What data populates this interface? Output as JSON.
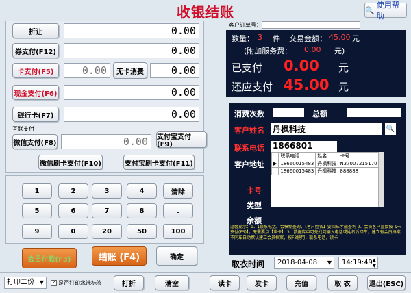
{
  "title": "收银结账",
  "help_button": "使用帮助",
  "left": {
    "discount": {
      "label": "折让",
      "value": "0.00"
    },
    "coupon": {
      "label": "券支付(F12)",
      "value": "0.00"
    },
    "card": {
      "label": "卡支付(F5)",
      "value": "0.00",
      "no_card_label": "无卡消费",
      "value2": "0.00"
    },
    "cash": {
      "label": "现金支付(F6)",
      "value": "0.00"
    },
    "bankcard": {
      "label": "银行卡(F7)",
      "value": "0.00"
    },
    "internet_label": "互联支付",
    "wechat": {
      "label": "微信支付(F8)",
      "value": "0.00"
    },
    "alipay_label": "支付宝支付(F9)",
    "wechat_swipe_label": "微信刷卡支付(F10)",
    "alipay_swipe_label": "支付宝刷卡支付(F11)"
  },
  "keypad": [
    "1",
    "2",
    "3",
    "4",
    "清除",
    "5",
    "6",
    "7",
    "8",
    ".",
    "9",
    "0",
    "20",
    "50",
    "100"
  ],
  "actions": {
    "order_pay": "会员付款(F3)",
    "checkout": "结账 (F4)",
    "confirm": "确定"
  },
  "summary": {
    "order_no_label": "客户订单号：",
    "qty_label": "数量：",
    "qty_value": "3",
    "qty_unit": "件",
    "amount_label": "交易金额：",
    "amount_value": "45.00",
    "amount_unit": "元",
    "service_label": "(附加服务费：",
    "service_value": "0.00",
    "service_unit": "元)",
    "paid_label": "已支付",
    "paid_value": "0.00",
    "paid_unit": "元",
    "due_label": "还应支付",
    "due_value": "45.00",
    "due_unit": "元"
  },
  "customer": {
    "visits_label": "消费次数",
    "total_label": "总额",
    "name_label": "客户姓名",
    "name_value": "丹枫科技",
    "phone_label": "联系电话",
    "phone_value": "1866801",
    "address_label": "客户地址",
    "card_label": "卡号",
    "type_label": "类型",
    "balance_label": "余额",
    "table_headers": [
      "联系电话",
      "姓名",
      "卡号"
    ],
    "table_rows": [
      [
        "18660015483",
        "丹枫科技",
        "N37007215170"
      ],
      [
        "18660015483",
        "丹枫科技",
        "888888"
      ]
    ],
    "tip": "温馨提示：1、【联系电话】会模糊查询，【客户姓名】要回车才能查询  2、会员客户直接按【卡支付(F5)】，无需要点【读卡】  3、数据库中可先找到输入电话或姓名后回车，建立有会员档案  不同车自动默认建立会员档案，按F3使用，联系电话，读卡"
  },
  "pickup": {
    "label": "取衣时间",
    "date": "2018-04-08",
    "time": "14:19:49"
  },
  "bottom": {
    "print_copies": "打印二份",
    "print_tag": "是否打印水洗标签",
    "buttons": [
      "打折",
      "清空",
      "读卡",
      "发卡",
      "充值",
      "取 衣",
      "退出(ESC)"
    ]
  }
}
